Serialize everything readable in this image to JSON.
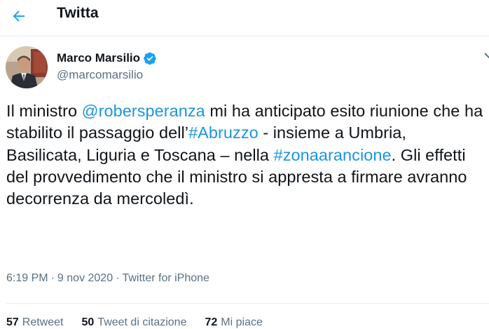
{
  "header": {
    "title": "Twitta",
    "back_icon": "arrow-left-icon",
    "accent_color": "#1da1f2"
  },
  "author": {
    "display_name": "Marco Marsilio",
    "handle": "@marcomarsilio",
    "verified_icon": "verified-badge-icon",
    "verified_color": "#1da1f2"
  },
  "tweet": {
    "parts": {
      "t1": "Il ministro ",
      "mention": "@robersperanza",
      "t2": " mi ha anticipato esito riunione che ha stabilito il passaggio dell’",
      "hashtag1": "#Abruzzo",
      "t3": " - insieme a Umbria, Basilicata, Liguria e Toscana – nella ",
      "hashtag2": "#zonaarancione",
      "t4": ". Gli effetti del provvedimento che il ministro si appresta a firmare avranno decorrenza da mercoledì."
    },
    "link_color": "#1b95e0"
  },
  "meta": {
    "time": "6:19 PM",
    "separator": "·",
    "date": "9 nov 2020",
    "source": "Twitter for iPhone"
  },
  "stats": {
    "retweets": {
      "count": "57",
      "label": "Retweet"
    },
    "quotes": {
      "count": "50",
      "label": "Tweet di citazione"
    },
    "likes": {
      "count": "72",
      "label": "Mi piace"
    }
  }
}
